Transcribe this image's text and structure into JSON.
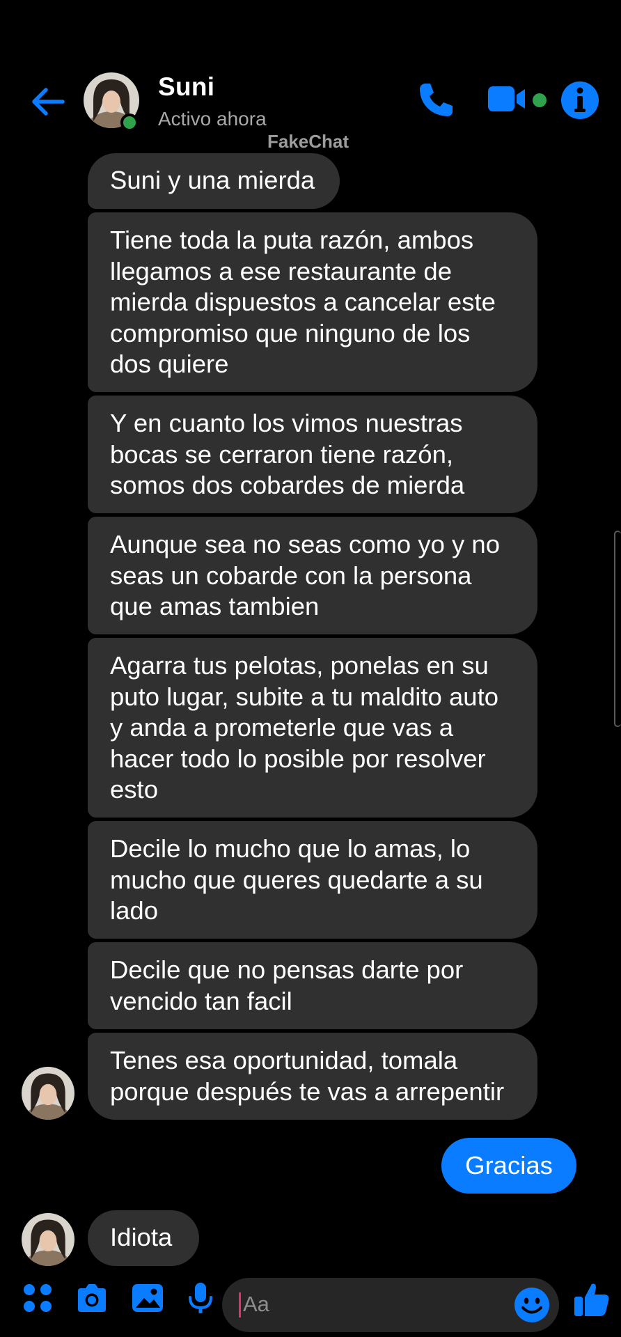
{
  "header": {
    "contact_name": "Suni",
    "status": "Activo ahora",
    "watermark": "FakeChat"
  },
  "colors": {
    "accent": "#0a7cff",
    "online": "#31a24c",
    "received_bubble": "#303030",
    "background": "#000000"
  },
  "icons": {
    "back": "arrow-left-icon",
    "call": "phone-icon",
    "video": "video-camera-icon",
    "info": "info-icon",
    "apps": "four-dots-icon",
    "camera": "camera-icon",
    "gallery": "image-icon",
    "voice": "microphone-icon",
    "emoji": "smiley-icon",
    "like": "thumbs-up-icon"
  },
  "messages": {
    "m1": "Suni y una mierda",
    "m2": "Tiene toda la puta razón, ambos\nllegamos a ese restaurante de\nmierda dispuestos a cancelar este\ncompromiso que ninguno de los\ndos quiere",
    "m3": "Y en cuanto los vimos nuestras\nbocas se cerraron tiene razón,\nsomos dos cobardes de mierda",
    "m4": "Aunque sea no seas como yo y no\nseas un cobarde con la persona\nque amas tambien",
    "m5": "Agarra tus pelotas, ponelas en su\nputo lugar, subite a tu maldito auto\ny anda a prometerle que vas a\nhacer todo lo posible por resolver\nesto",
    "m6": "Decile lo mucho que lo amas, lo\nmucho que queres quedarte a su\nlado",
    "m7": "Decile que no pensas darte por\nvencido tan facil",
    "m8": "Tenes esa oportunidad, tomala\nporque después te vas a arrepentir",
    "sent1": "Gracias",
    "m9": "Idiota"
  },
  "composer": {
    "placeholder": "Aa"
  }
}
